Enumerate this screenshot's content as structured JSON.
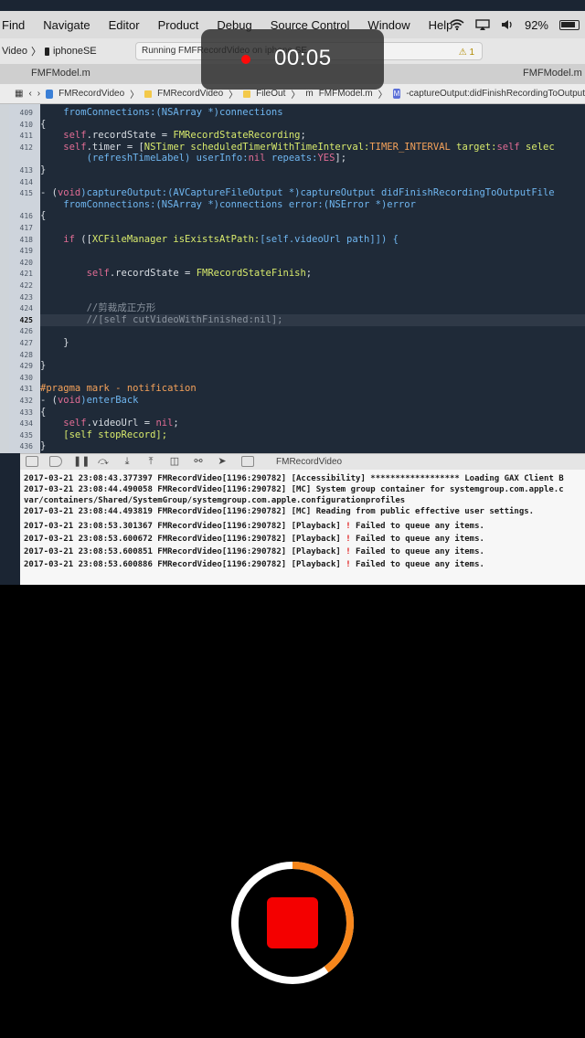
{
  "menubar": {
    "items": [
      "Find",
      "Navigate",
      "Editor",
      "Product",
      "Debug",
      "Source Control",
      "Window",
      "Help"
    ],
    "battery": "92%"
  },
  "toolbar": {
    "scheme_target": "Video",
    "device": "iphoneSE",
    "status": "Running FMFRecordVideo on iphone SE",
    "warning_count": "1"
  },
  "tabs": {
    "left": "FMFModel.m",
    "right": "FMFModel.m"
  },
  "jumpbar": {
    "project": "FMRecordVideo",
    "group": "FMRecordVideo",
    "folder": "FileOut",
    "file": "FMFModel.m",
    "method": "-captureOutput:didFinishRecordingToOutput"
  },
  "editor": {
    "current_line": "425",
    "lines": [
      {
        "n": "409",
        "segments": [
          {
            "t": "    fromConnections:(",
            "c": "#6fb6f0"
          },
          {
            "t": "NSArray",
            "c": "#6fb6f0"
          },
          {
            "t": " *)connections",
            "c": "#6fb6f0"
          }
        ]
      },
      {
        "n": "410",
        "segments": [
          {
            "t": "{",
            "c": "#d8dde3"
          }
        ]
      },
      {
        "n": "411",
        "segments": [
          {
            "t": "    self",
            "c": "#e06c94"
          },
          {
            "t": ".recordState = ",
            "c": "#d8dde3"
          },
          {
            "t": "FMRecordStateRecording",
            "c": "#d8ea6c"
          },
          {
            "t": ";",
            "c": "#d8dde3"
          }
        ]
      },
      {
        "n": "412",
        "segments": [
          {
            "t": "    self",
            "c": "#e06c94"
          },
          {
            "t": ".timer = [",
            "c": "#d8dde3"
          },
          {
            "t": "NSTimer scheduledTimerWithTimeInterval:",
            "c": "#d8ea6c"
          },
          {
            "t": "TIMER_INTERVAL",
            "c": "#f5a25a"
          },
          {
            "t": " target:",
            "c": "#d8ea6c"
          },
          {
            "t": "self",
            "c": "#e06c94"
          },
          {
            "t": " selec",
            "c": "#d8ea6c"
          }
        ]
      },
      {
        "n": "",
        "segments": [
          {
            "t": "        (refreshTimeLabel) userInfo:",
            "c": "#6fb6f0"
          },
          {
            "t": "nil",
            "c": "#e06c94"
          },
          {
            "t": " repeats:",
            "c": "#6fb6f0"
          },
          {
            "t": "YES",
            "c": "#e06c94"
          },
          {
            "t": "];",
            "c": "#d8dde3"
          }
        ]
      },
      {
        "n": "413",
        "segments": [
          {
            "t": "}",
            "c": "#d8dde3"
          }
        ]
      },
      {
        "n": "414",
        "segments": []
      },
      {
        "n": "415",
        "segments": [
          {
            "t": "- (",
            "c": "#d8dde3"
          },
          {
            "t": "void",
            "c": "#e06c94"
          },
          {
            "t": ")captureOutput:(AVCaptureFileOutput *)captureOutput didFinishRecordingToOutputFile",
            "c": "#6fb6f0"
          }
        ]
      },
      {
        "n": "",
        "segments": [
          {
            "t": "    fromConnections:(NSArray *)connections error:(NSError *)error",
            "c": "#6fb6f0"
          }
        ]
      },
      {
        "n": "416",
        "segments": [
          {
            "t": "{",
            "c": "#d8dde3"
          }
        ]
      },
      {
        "n": "417",
        "segments": []
      },
      {
        "n": "418",
        "segments": [
          {
            "t": "    if",
            "c": "#e06c94"
          },
          {
            "t": " ([",
            "c": "#d8dde3"
          },
          {
            "t": "XCFileManager isExistsAtPath:",
            "c": "#d8ea6c"
          },
          {
            "t": "[self.videoUrl path]]) {",
            "c": "#6fb6f0"
          }
        ]
      },
      {
        "n": "419",
        "segments": []
      },
      {
        "n": "420",
        "segments": []
      },
      {
        "n": "421",
        "segments": [
          {
            "t": "        self",
            "c": "#e06c94"
          },
          {
            "t": ".recordState = ",
            "c": "#d8dde3"
          },
          {
            "t": "FMRecordStateFinish",
            "c": "#d8ea6c"
          },
          {
            "t": ";",
            "c": "#d8dde3"
          }
        ]
      },
      {
        "n": "422",
        "segments": []
      },
      {
        "n": "423",
        "segments": []
      },
      {
        "n": "424",
        "segments": [
          {
            "t": "        //剪裁成正方形",
            "c": "#8a939e"
          }
        ]
      },
      {
        "n": "425",
        "segments": [
          {
            "t": "        //[self cutVideoWithFinished:nil];",
            "c": "#8a939e"
          }
        ]
      },
      {
        "n": "426",
        "segments": []
      },
      {
        "n": "427",
        "segments": [
          {
            "t": "    }",
            "c": "#d8dde3"
          }
        ]
      },
      {
        "n": "428",
        "segments": []
      },
      {
        "n": "429",
        "segments": [
          {
            "t": "}",
            "c": "#d8dde3"
          }
        ]
      },
      {
        "n": "430",
        "segments": []
      },
      {
        "n": "431",
        "segments": [
          {
            "t": "#pragma mark - notification",
            "c": "#f5a25a"
          }
        ]
      },
      {
        "n": "432",
        "segments": [
          {
            "t": "- (",
            "c": "#d8dde3"
          },
          {
            "t": "void",
            "c": "#e06c94"
          },
          {
            "t": ")enterBack",
            "c": "#6fb6f0"
          }
        ]
      },
      {
        "n": "433",
        "segments": [
          {
            "t": "{",
            "c": "#d8dde3"
          }
        ]
      },
      {
        "n": "434",
        "segments": [
          {
            "t": "    self",
            "c": "#e06c94"
          },
          {
            "t": ".videoUrl = ",
            "c": "#d8dde3"
          },
          {
            "t": "nil",
            "c": "#e06c94"
          },
          {
            "t": ";",
            "c": "#d8dde3"
          }
        ]
      },
      {
        "n": "435",
        "segments": [
          {
            "t": "    [self stopRecord];",
            "c": "#d8ea6c"
          }
        ]
      },
      {
        "n": "436",
        "segments": [
          {
            "t": "}",
            "c": "#d8dde3"
          }
        ]
      }
    ]
  },
  "debug_area": {
    "target": "FMRecordVideo",
    "logs": [
      {
        "bang": false,
        "text": "2017-03-21 23:08:43.377397 FMRecordVideo[1196:290782] [Accessibility] ****************** Loading GAX Client B"
      },
      {
        "bang": false,
        "text": "2017-03-21 23:08:44.490058 FMRecordVideo[1196:290782] [MC] System group container for systemgroup.com.apple.c"
      },
      {
        "bang": false,
        "text": "var/containers/Shared/SystemGroup/systemgroup.com.apple.configurationprofiles"
      },
      {
        "bang": false,
        "text": "2017-03-21 23:08:44.493819 FMRecordVideo[1196:290782] [MC] Reading from public effective user settings."
      },
      {
        "bang": true,
        "text": "2017-03-21 23:08:53.301367 FMRecordVideo[1196:290782] [Playback] ",
        "after": " Failed to queue any items."
      },
      {
        "bang": true,
        "text": "2017-03-21 23:08:53.600672 FMRecordVideo[1196:290782] [Playback] ",
        "after": " Failed to queue any items."
      },
      {
        "bang": true,
        "text": "2017-03-21 23:08:53.600851 FMRecordVideo[1196:290782] [Playback] ",
        "after": " Failed to queue any items."
      },
      {
        "bang": true,
        "text": "2017-03-21 23:08:53.600886 FMRecordVideo[1196:290782] [Playback] ",
        "after": " Failed to queue any items."
      }
    ]
  },
  "recording": {
    "elapsed": "00:05",
    "progress": 0.4,
    "ring_color": "#f7861b",
    "ring_track_color": "#ffffff",
    "stop_color": "#f40000"
  }
}
